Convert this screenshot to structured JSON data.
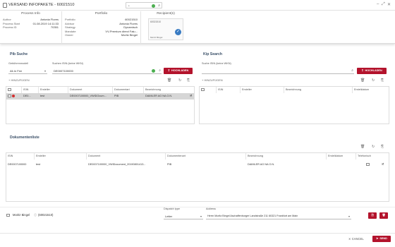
{
  "window": {
    "title": "VERSAND INFOPAKETE - 60021510",
    "search_value": "*"
  },
  "process_info": {
    "heading": "Process Info",
    "rows": [
      {
        "k": "Author",
        "v": "Antonia Flores"
      },
      {
        "k": "Process Start",
        "v": "01.08.2019 14:11:33"
      },
      {
        "k": "Process ID",
        "v": "70351"
      }
    ]
  },
  "portfolio": {
    "heading": "Portfolio",
    "rows": [
      {
        "k": "Portfolio",
        "v": "60021510"
      },
      {
        "k": "Advisor",
        "v": "Antonia Flores"
      },
      {
        "k": "Strategy",
        "v": "Dynamisch"
      },
      {
        "k": "Mandate",
        "v": "VV-Premium direct Falu..."
      },
      {
        "k": "Owner",
        "v": "Moritz Bingel"
      }
    ]
  },
  "recipients": {
    "heading": "Recipient(s)",
    "card_id": "60021510",
    "card_name": "Moritz Bingel"
  },
  "pib": {
    "title": "Pib Suche",
    "filter_label": "Gebührenmodell",
    "filter_value": "All-In Fee",
    "search_label": "Suchen ISIN (keine WKN)",
    "search_value": "DE0007100000",
    "upload_label": "HOCHLADEN",
    "add_label": "HINZUFÜGEN",
    "columns": [
      "ISIN",
      "Ersteller",
      "Dokument",
      "Dokumentart",
      "Bezeichnung"
    ],
    "rows": [
      {
        "isin": "DE0...",
        "ersteller": "test",
        "dokument": "DE0007100000_VWIDOcum...",
        "art": "PIB",
        "bez": "DAIMLER AG NA O.N."
      }
    ]
  },
  "kip": {
    "title": "Kip Search",
    "search_label": "Suche ISIN (keine WKN)",
    "search_value": "",
    "upload_label": "HOCHLADEN",
    "add_label": "HINZUFÜGEN",
    "columns": [
      "ISIN",
      "Ersteller",
      "Bezeichnung",
      "Erstelldatum"
    ]
  },
  "doclist": {
    "title": "Dokumentenliste",
    "columns": [
      "ISIN",
      "Ersteller",
      "Dokument",
      "Dokumentenart",
      "Bezeichnung",
      "Erstelldatum",
      "Telefonisch"
    ],
    "rows": [
      {
        "isin": "DE0007100000",
        "ersteller": "test",
        "dokument": "DE0007100000_VWIDocument_20190801413...",
        "art": "PIB",
        "bez": "DAIMLER AG NA O.N.",
        "datum": ""
      }
    ]
  },
  "footer": {
    "recipient": "Moritz Bingel",
    "recipient_id": "(60021510)",
    "dispatch_label": "Dispatch type",
    "dispatch_value": "Letter",
    "address_label": "Address",
    "address_value": "Herrn Moritz Bingel Aschaffenburger Landstraße 211 60321 Frankfurt am Main",
    "cancel_label": "CANCEL",
    "send_label": "SEND"
  },
  "colors": {
    "accent": "#b3132c",
    "success": "#4caf50"
  }
}
